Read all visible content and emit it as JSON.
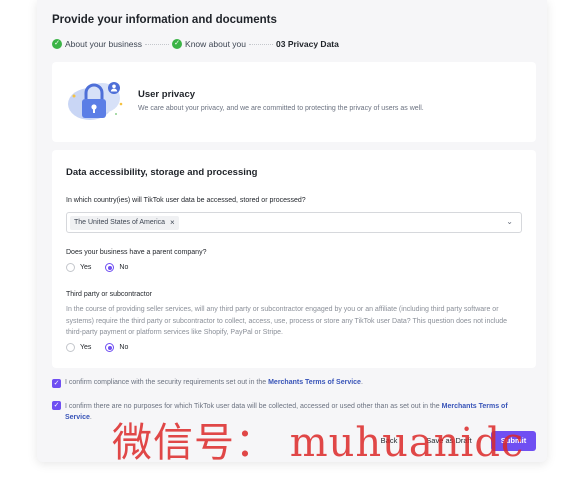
{
  "page": {
    "title": "Provide your information and documents"
  },
  "steps": [
    {
      "label": "About your business",
      "done": true
    },
    {
      "label": "Know about you",
      "done": true
    },
    {
      "label": "03 Privacy Data",
      "done": false
    }
  ],
  "privacy": {
    "title": "User privacy",
    "description": "We care about your privacy, and we are committed to protecting the privacy of users as well."
  },
  "data_section": {
    "title": "Data accessibility, storage and processing",
    "country_question": "In which country(ies) will TikTok user data be accessed, stored or processed?",
    "selected_country": "The United States of America",
    "parent_question": "Does your business have a parent company?",
    "parent_selected": "No",
    "third_party_title": "Third party or subcontractor",
    "third_party_body": "In the course of providing seller services, will any third party or subcontractor engaged by you or an affiliate (including third party software or systems) require the third party or subcontractor to collect, access, use, process or store any TikTok user Data? This question does not include third-party payment or platform services like Shopify, PayPal or Stripe.",
    "third_party_selected": "No",
    "yes_label": "Yes",
    "no_label": "No"
  },
  "confirmations": {
    "c1_text": "I confirm compliance with the security requirements set out in the ",
    "c1_link": "Merchants Terms of Service",
    "c1_end": ".",
    "c2_text": "I confirm there are no purposes for which TikTok user data will be collected, accessed or used other than as set out in the ",
    "c2_link": "Merchants Terms of Service",
    "c2_end": "."
  },
  "buttons": {
    "back": "Back",
    "save_draft": "Save as Draft",
    "submit": "Submit"
  },
  "watermark": "微信号： muhuanidc",
  "colors": {
    "accent": "#6f4ff2",
    "success": "#3bb346",
    "link": "#3854b8"
  }
}
